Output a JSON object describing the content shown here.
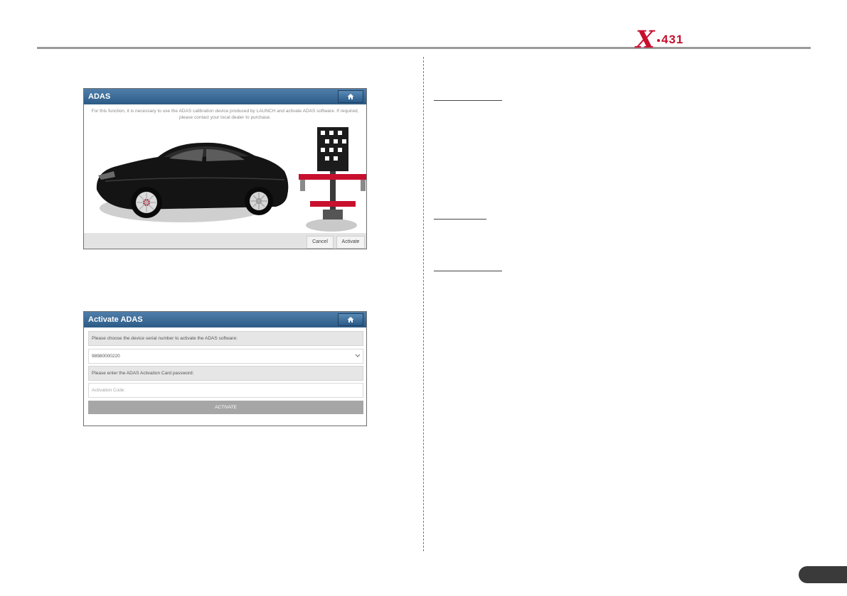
{
  "brand": {
    "logo_text": "X·431",
    "logo_color": "#c8102e"
  },
  "screen_adas": {
    "title": "ADAS",
    "home_icon": "home-icon",
    "notice": "For this function, it is necessary to use the ADAS calibration device produced by LAUNCH and activate ADAS software. If required, please contact your local dealer to purchase.",
    "illustration": "car-and-calibration-frame",
    "buttons": {
      "cancel": "Cancel",
      "activate": "Activate"
    }
  },
  "screen_activate": {
    "title": "Activate ADAS",
    "home_icon": "home-icon",
    "serial_prompt": "Please choose the device serial number to activate the ADAS software:",
    "serial_value": "98980000220",
    "password_prompt": "Please enter the ADAS Activation Card password:",
    "code_placeholder": "Activation Code",
    "activate_button": "ACTIVATE"
  },
  "colors": {
    "titlebar": "#2c5b86",
    "accent_red": "#c8102e",
    "page_tab": "#3a3a3a"
  }
}
